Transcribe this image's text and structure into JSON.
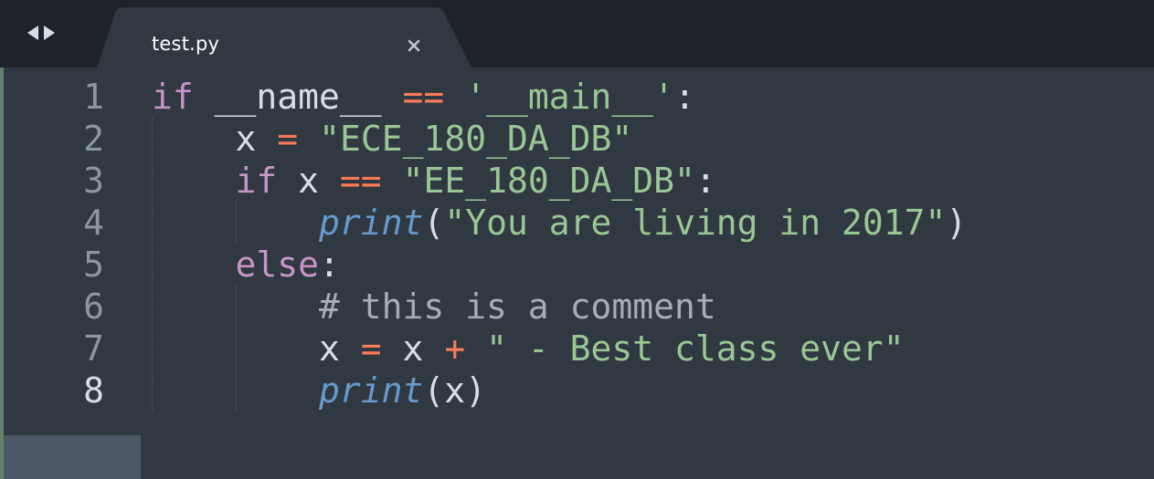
{
  "tabbar": {
    "nav_icon_left": "triangle-left-icon",
    "nav_icon_right": "triangle-right-icon",
    "tab_title": "test.py",
    "close_icon": "close-icon"
  },
  "colors": {
    "background": "#303841",
    "tabbar": "#1d2329",
    "keyword": "#c695c6",
    "operator": "#f97b58",
    "string": "#99c794",
    "function": "#6699cc",
    "comment": "#a6acb9",
    "text": "#d8dee9"
  },
  "editor": {
    "active_line": 8,
    "lines": [
      {
        "num": "1",
        "tokens": [
          {
            "t": "if",
            "c": "keyword"
          },
          {
            "t": " __name__ ",
            "c": "plain"
          },
          {
            "t": "==",
            "c": "op"
          },
          {
            "t": " ",
            "c": "plain"
          },
          {
            "t": "'__main__'",
            "c": "string"
          },
          {
            "t": ":",
            "c": "plain"
          }
        ]
      },
      {
        "num": "2",
        "tokens": [
          {
            "t": "    x ",
            "c": "plain"
          },
          {
            "t": "=",
            "c": "op"
          },
          {
            "t": " ",
            "c": "plain"
          },
          {
            "t": "\"ECE_180_DA_DB\"",
            "c": "string"
          }
        ]
      },
      {
        "num": "3",
        "tokens": [
          {
            "t": "    ",
            "c": "plain"
          },
          {
            "t": "if",
            "c": "keyword"
          },
          {
            "t": " x ",
            "c": "plain"
          },
          {
            "t": "==",
            "c": "op"
          },
          {
            "t": " ",
            "c": "plain"
          },
          {
            "t": "\"EE_180_DA_DB\"",
            "c": "string"
          },
          {
            "t": ":",
            "c": "plain"
          }
        ]
      },
      {
        "num": "4",
        "tokens": [
          {
            "t": "        ",
            "c": "plain"
          },
          {
            "t": "print",
            "c": "func"
          },
          {
            "t": "(",
            "c": "plain"
          },
          {
            "t": "\"You are living in 2017\"",
            "c": "string"
          },
          {
            "t": ")",
            "c": "plain"
          }
        ]
      },
      {
        "num": "5",
        "tokens": [
          {
            "t": "    ",
            "c": "plain"
          },
          {
            "t": "else",
            "c": "keyword"
          },
          {
            "t": ":",
            "c": "plain"
          }
        ]
      },
      {
        "num": "6",
        "tokens": [
          {
            "t": "        ",
            "c": "plain"
          },
          {
            "t": "# this is a comment",
            "c": "comment"
          }
        ]
      },
      {
        "num": "7",
        "tokens": [
          {
            "t": "        x ",
            "c": "plain"
          },
          {
            "t": "=",
            "c": "op"
          },
          {
            "t": " x ",
            "c": "plain"
          },
          {
            "t": "+",
            "c": "op"
          },
          {
            "t": " ",
            "c": "plain"
          },
          {
            "t": "\" - Best class ever\"",
            "c": "string"
          }
        ]
      },
      {
        "num": "8",
        "tokens": [
          {
            "t": "        ",
            "c": "plain"
          },
          {
            "t": "print",
            "c": "func"
          },
          {
            "t": "(x)",
            "c": "plain"
          }
        ]
      }
    ]
  }
}
